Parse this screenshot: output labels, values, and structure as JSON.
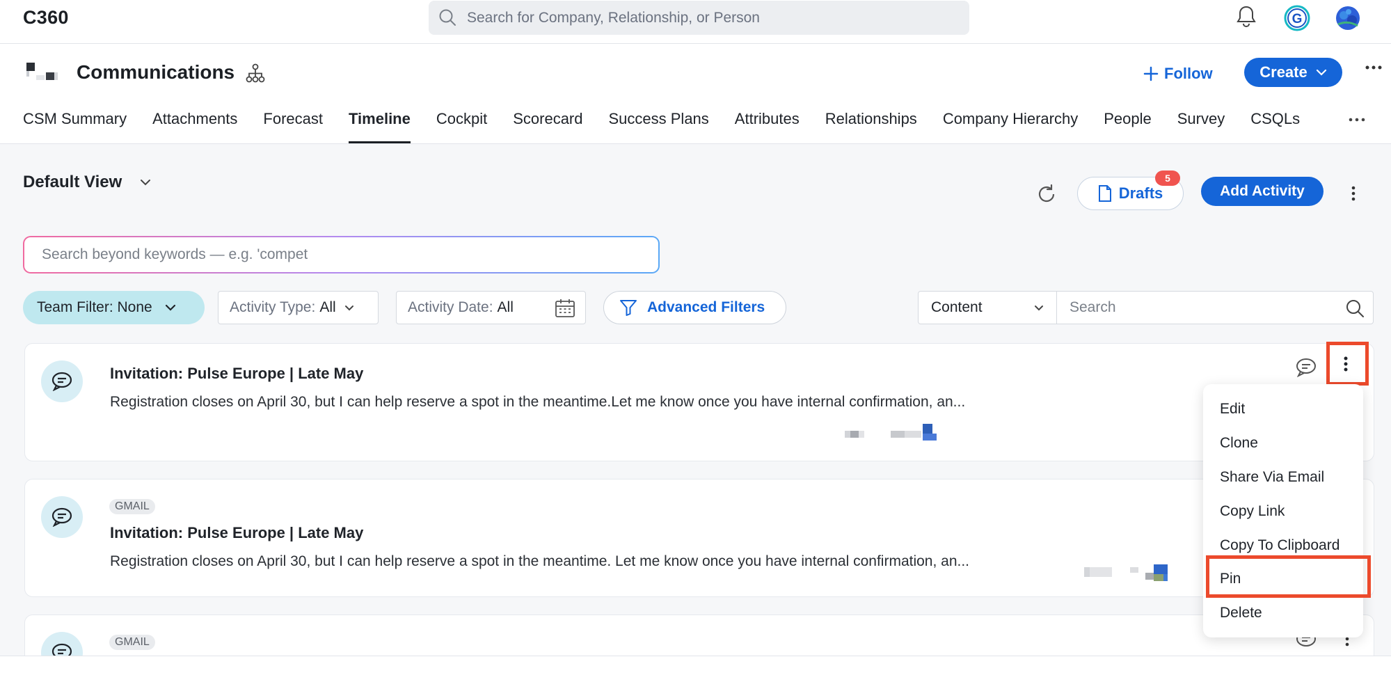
{
  "app": {
    "brand": "C360"
  },
  "global_search": {
    "placeholder": "Search for Company, Relationship, or Person"
  },
  "header": {
    "company_name": "Communications",
    "follow_label": "Follow",
    "create_label": "Create"
  },
  "tabs": [
    {
      "label": "CSM Summary",
      "active": false
    },
    {
      "label": "Attachments",
      "active": false
    },
    {
      "label": "Forecast",
      "active": false
    },
    {
      "label": "Timeline",
      "active": true
    },
    {
      "label": "Cockpit",
      "active": false
    },
    {
      "label": "Scorecard",
      "active": false
    },
    {
      "label": "Success Plans",
      "active": false
    },
    {
      "label": "Attributes",
      "active": false
    },
    {
      "label": "Relationships",
      "active": false
    },
    {
      "label": "Company Hierarchy",
      "active": false
    },
    {
      "label": "People",
      "active": false
    },
    {
      "label": "Survey",
      "active": false
    },
    {
      "label": "CSQLs",
      "active": false
    }
  ],
  "timeline": {
    "view_name": "Default View",
    "drafts_label": "Drafts",
    "drafts_count": "5",
    "add_activity_label": "Add Activity",
    "ai_search_placeholder": "Search beyond keywords — e.g. 'compet",
    "filters": {
      "team_filter": "Team Filter: None",
      "activity_type_label": "Activity Type:",
      "activity_type_value": "All",
      "activity_date_label": "Activity Date:",
      "activity_date_value": "All",
      "advanced_filters": "Advanced Filters",
      "content_select": "Content",
      "search_placeholder": "Search"
    }
  },
  "activities": [
    {
      "tag": "",
      "title": "Invitation: Pulse Europe | Late May",
      "body": "Registration closes on April 30, but I can help reserve a spot in the meantime.Let me know once you have internal confirmation, an..."
    },
    {
      "tag": "GMAIL",
      "title": "Invitation: Pulse Europe | Late May",
      "body": "Registration closes on April 30, but I can help reserve a spot in the meantime. Let me know once you have internal confirmation, an..."
    },
    {
      "tag": "GMAIL",
      "title": "",
      "body": ""
    }
  ],
  "context_menu": {
    "items": [
      "Edit",
      "Clone",
      "Share Via Email",
      "Copy Link",
      "Copy To Clipboard",
      "Pin",
      "Delete"
    ],
    "highlighted": "Pin"
  },
  "colors": {
    "primary": "#1565d8",
    "highlight": "#ec4a2c",
    "badge": "#f0544f",
    "team_filter_bg": "#bfe8ef"
  }
}
